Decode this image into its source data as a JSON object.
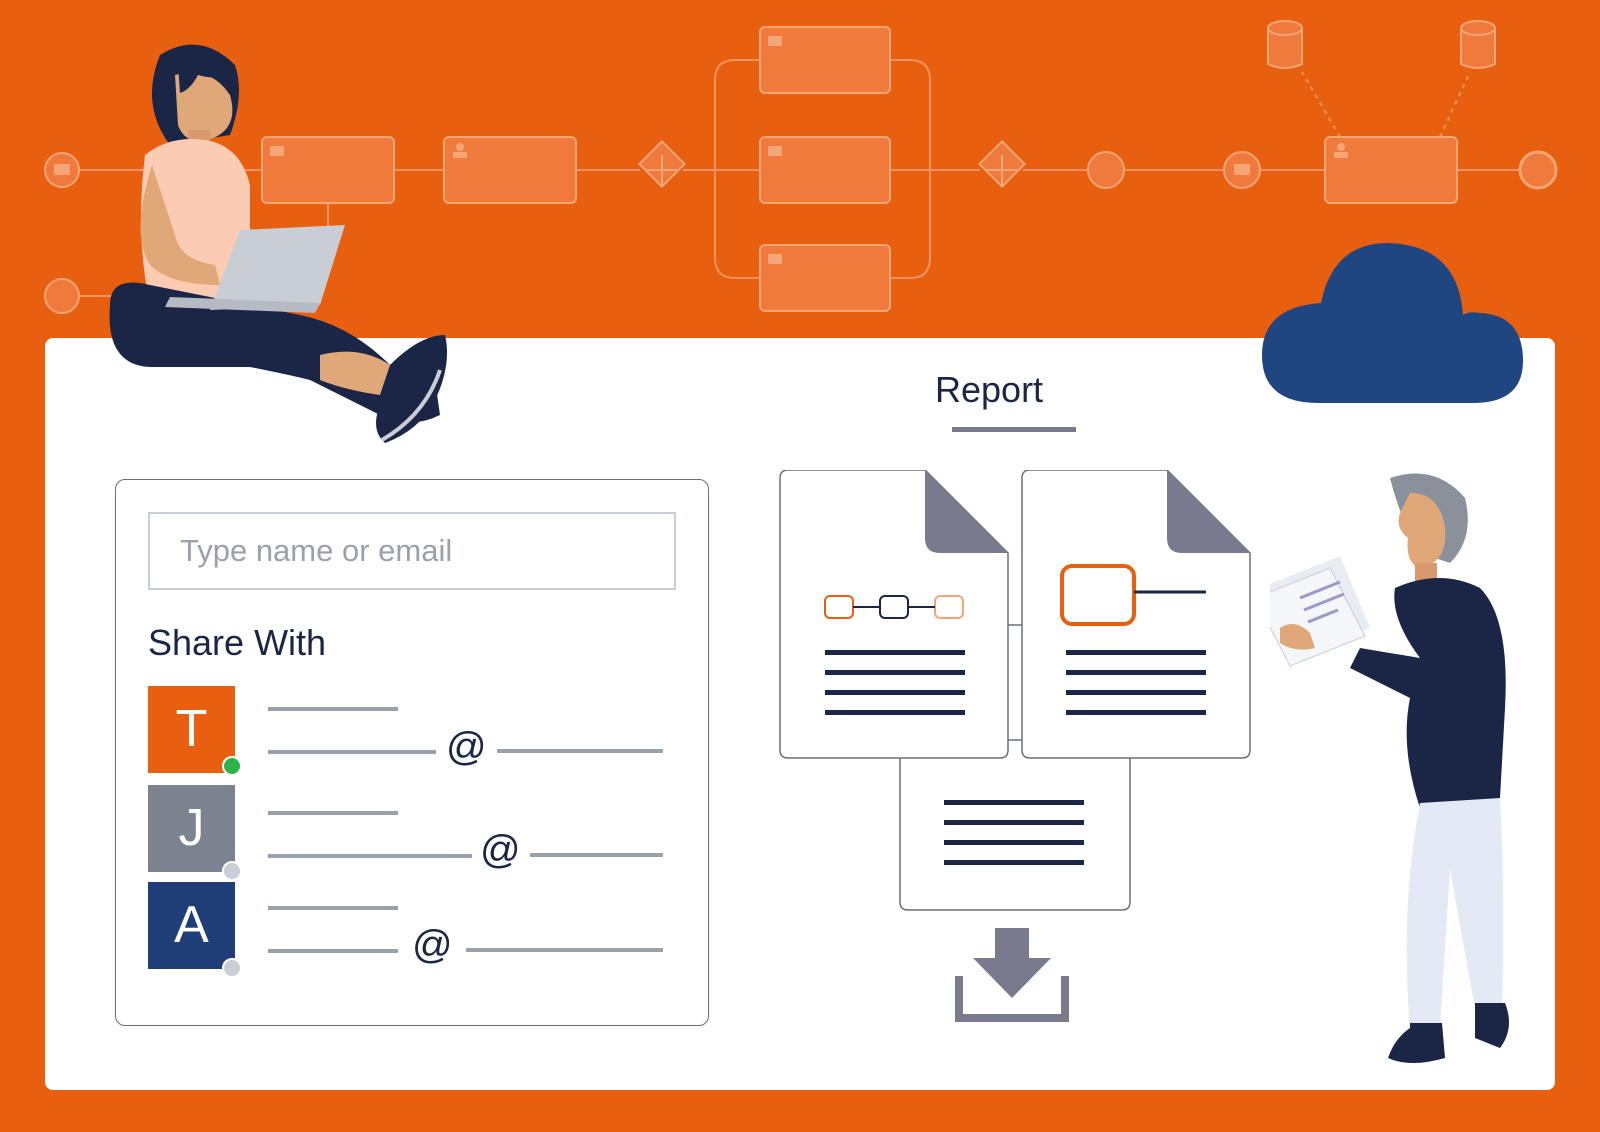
{
  "colors": {
    "background": "#E8600F",
    "panel": "#FFFFFF",
    "navy": "#1B2545",
    "cloud": "#1F4680",
    "gray": "#9AA1AC",
    "online": "#2DB34A",
    "offline": "#C9CDD4"
  },
  "share": {
    "search_placeholder": "Type name or email",
    "title": "Share With",
    "contacts": [
      {
        "initial": "T",
        "color": "#E8600F",
        "status": "online"
      },
      {
        "initial": "J",
        "color": "#7B8290",
        "status": "offline"
      },
      {
        "initial": "A",
        "color": "#1F3E78",
        "status": "offline"
      }
    ],
    "at_symbol": "@"
  },
  "report": {
    "title": "Report",
    "download_icon": "download-icon"
  },
  "icons": [
    "envelope-icon",
    "user-icon",
    "gateway-icon",
    "timer-icon",
    "database-icon",
    "cloud-icon",
    "download-icon"
  ]
}
